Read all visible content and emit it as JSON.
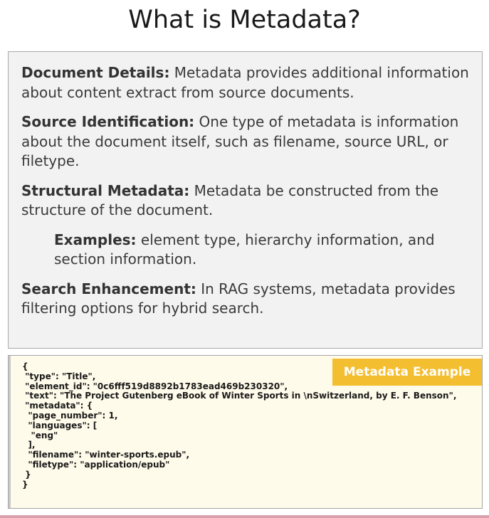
{
  "title": "What is Metadata?",
  "info": {
    "items": [
      {
        "term": "Document Details:",
        "text": " Metadata provides additional information about content extract from source documents."
      },
      {
        "term": "Source Identification:",
        "text": " One type of metadata is information about the document itself, such as filename, source URL, or filetype."
      },
      {
        "term": "Structural Metadata:",
        "text": " Metadata be constructed from the structure of the document."
      },
      {
        "term": "Examples:",
        "text": " element type, hierarchy information, and section information."
      },
      {
        "term": "Search Enhancement:",
        "text": " In RAG systems, metadata provides filtering options for hybrid search."
      }
    ]
  },
  "example": {
    "badge": "Metadata Example",
    "code": "{\n \"type\": \"Title\",\n \"element_id\": \"0c6fff519d8892b1783ead469b230320\",\n \"text\": \"The Project Gutenberg eBook of Winter Sports in \\nSwitzerland, by E. F. Benson\",\n \"metadata\": {\n  \"page_number\": 1,\n  \"languages\": [\n   \"eng\"\n  ],\n  \"filename\": \"winter-sports.epub\",\n  \"filetype\": \"application/epub\"\n }\n}"
  }
}
